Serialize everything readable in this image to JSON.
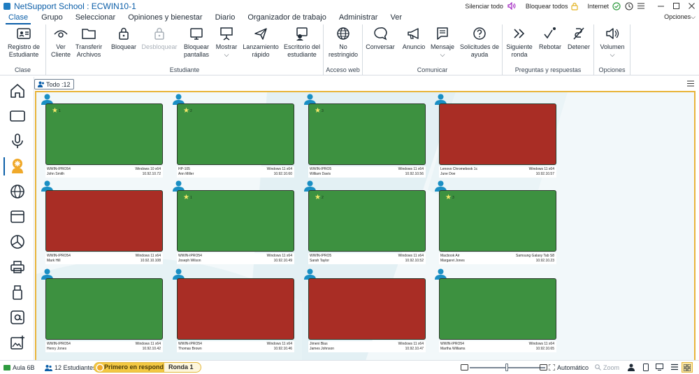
{
  "window": {
    "title": "NetSupport School : ECWIN10-1",
    "silence_label": "Silenciar todo",
    "lock_all_label": "Bloquear todos",
    "internet_label": "Internet"
  },
  "menu": {
    "items": [
      "Clase",
      "Grupo",
      "Seleccionar",
      "Opiniones y bienestar",
      "Diario",
      "Organizador de trabajo",
      "Administrar",
      "Ver"
    ],
    "options_label": "Opciones"
  },
  "ribbon": {
    "groups": [
      {
        "label": "Clase",
        "buttons": [
          "Registro de\nEstudiante"
        ]
      },
      {
        "label": "Estudiante",
        "buttons": [
          "Ver\nCliente",
          "Transferir\nArchivos",
          "Bloquear",
          "Desbloquear",
          "Bloquear\npantallas",
          "Mostrar",
          "Lanzamiento\nrápido",
          "Escritorio del\nestudiante"
        ]
      },
      {
        "label": "Acceso web",
        "buttons": [
          "No\nrestringido"
        ]
      },
      {
        "label": "Comunicar",
        "buttons": [
          "Conversar",
          "Anuncio",
          "Mensaje",
          "Solicitudes de\nayuda"
        ]
      },
      {
        "label": "Preguntas y respuestas",
        "buttons": [
          "Siguiente\nronda",
          "Rebotar",
          "Detener"
        ]
      },
      {
        "label": "Opciones",
        "buttons": [
          "Volumen"
        ]
      }
    ],
    "dropdown_mark": "⌵"
  },
  "sidebar": {
    "icons": [
      "home-icon",
      "screen-icon",
      "microphone-icon",
      "student-idea-icon",
      "globe-icon",
      "browser-window-icon",
      "pie-chart-icon",
      "printer-icon",
      "usb-drive-icon",
      "application-icon",
      "image-add-icon"
    ]
  },
  "view": {
    "filter_label": "Todo",
    "filter_count": ":12"
  },
  "students": [
    {
      "device": "WWIN-IPRO54",
      "user": "John Smith",
      "os": "Windows 10 x64",
      "ip": "10.92.10.72",
      "status": "green",
      "star": "1"
    },
    {
      "device": "HP-105",
      "user": "Ann Miller",
      "os": "Windows 11 x64",
      "ip": "10.92.10.60",
      "status": "green",
      "star": "2"
    },
    {
      "device": "WWIN-IPRO5",
      "user": "William Davis",
      "os": "Windows 11 x64",
      "ip": "10.92.10.56",
      "status": "green",
      "star": "3"
    },
    {
      "device": "Lenovo Chromebook 1c",
      "user": "June Doe",
      "os": "Windows 11 x64",
      "ip": "10.92.10.57",
      "status": "red",
      "star": ""
    },
    {
      "device": "WWIN-IPRO54",
      "user": "Mark Hill",
      "os": "Windows 11 x64",
      "ip": "10.92.10.108",
      "status": "red",
      "star": ""
    },
    {
      "device": "WWIN-IPRO54",
      "user": "Joseph Wilson",
      "os": "Windows 11 x64",
      "ip": "10.92.10.49",
      "status": "green",
      "star": "1"
    },
    {
      "device": "WWIN-IPRO5",
      "user": "Sarah Taylor",
      "os": "Windows 11 x64",
      "ip": "10.92.10.52",
      "status": "green",
      "star": "2"
    },
    {
      "device": "Macbook Air",
      "user": "Margaret Jones",
      "os": "Samsung Galaxy Tab S8",
      "ip": "10.92.10.23",
      "status": "green",
      "star": "3"
    },
    {
      "device": "WWIN-IPRO54",
      "user": "Henry Jones",
      "os": "Windows 11 x64",
      "ip": "10.92.10.42",
      "status": "green",
      "star": ""
    },
    {
      "device": "WWIN-IPRO54",
      "user": "Thomas Brown",
      "os": "Windows 11 x64",
      "ip": "10.92.10.46",
      "status": "red",
      "star": ""
    },
    {
      "device": "Jimeni Bias",
      "user": "James Johnson",
      "os": "Windows 11 x64",
      "ip": "10.92.10.47",
      "status": "red",
      "star": ""
    },
    {
      "device": "WWIN-IPRO54",
      "user": "Martha Williams",
      "os": "Windows 11 x64",
      "ip": "10.92.10.65",
      "status": "green",
      "star": ""
    }
  ],
  "status": {
    "room_label": "Aula 6B",
    "students_label": "12 Estudiantes",
    "first_responder_label": "Primero en responder",
    "round_label": "Ronda 1",
    "auto_label": "Automático",
    "zoom_label": "Zoom"
  },
  "colors": {
    "accent": "#0b5ea8",
    "online_green": "#3d9140",
    "locked_red": "#a92d25",
    "highlight_gold": "#e8b43a"
  }
}
